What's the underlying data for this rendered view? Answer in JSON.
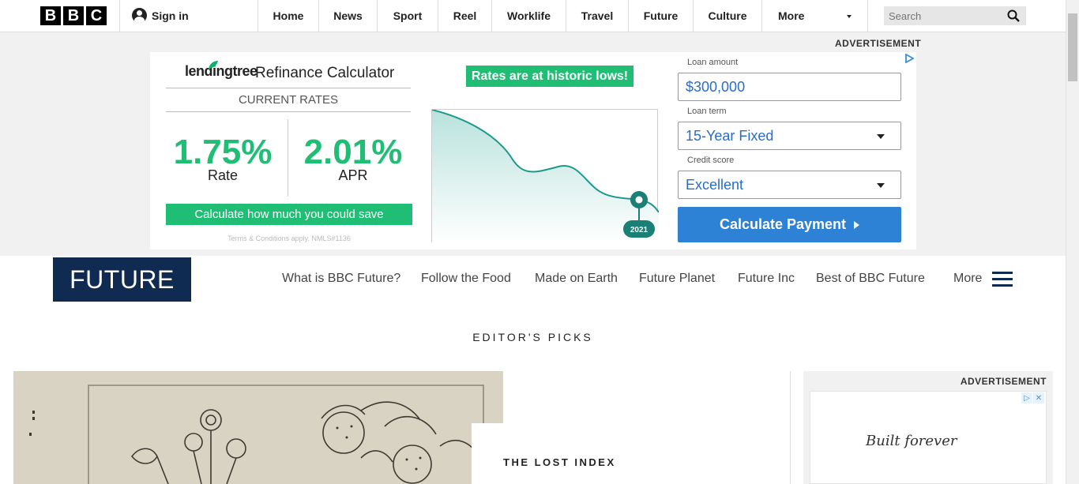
{
  "header": {
    "logo_letters": [
      "B",
      "B",
      "C"
    ],
    "signin_label": "Sign in",
    "nav": [
      {
        "label": "Home"
      },
      {
        "label": "News"
      },
      {
        "label": "Sport"
      },
      {
        "label": "Reel"
      },
      {
        "label": "Worklife"
      },
      {
        "label": "Travel"
      },
      {
        "label": "Future"
      },
      {
        "label": "Culture"
      }
    ],
    "more_label": "More",
    "search_placeholder": "Search"
  },
  "top_ad": {
    "label": "ADVERTISEMENT",
    "brand": "lendingtree",
    "title": "Refinance Calculator",
    "current_rates": "CURRENT RATES",
    "rate_value": "1.75%",
    "rate_label": "Rate",
    "apr_value": "2.01%",
    "apr_label": "APR",
    "calc_save": "Calculate how much you could save",
    "terms": "Terms & Conditions apply. NMLS#1136",
    "banner": "Rates are at historic lows!",
    "chart_year": "2021",
    "loan_amount_label": "Loan amount",
    "loan_amount_value": "$300,000",
    "loan_term_label": "Loan term",
    "loan_term_value": "15-Year Fixed",
    "credit_label": "Credit score",
    "credit_value": "Excellent",
    "calc_payment": "Calculate Payment",
    "accent": "#1fbe74",
    "button_blue": "#2d82d6"
  },
  "section": {
    "logo": "FUTURE",
    "nav": [
      {
        "label": "What is BBC Future?"
      },
      {
        "label": "Follow the Food"
      },
      {
        "label": "Made on Earth"
      },
      {
        "label": "Future Planet"
      },
      {
        "label": "Future Inc"
      },
      {
        "label": "Best of BBC Future"
      }
    ],
    "more_label": "More",
    "brand_navy": "#0f2b52"
  },
  "editors_picks": {
    "heading": "EDITOR'S PICKS",
    "lead_kicker": "THE LOST INDEX"
  },
  "side_ad": {
    "label": "ADVERTISEMENT",
    "signature": "Built forever"
  }
}
